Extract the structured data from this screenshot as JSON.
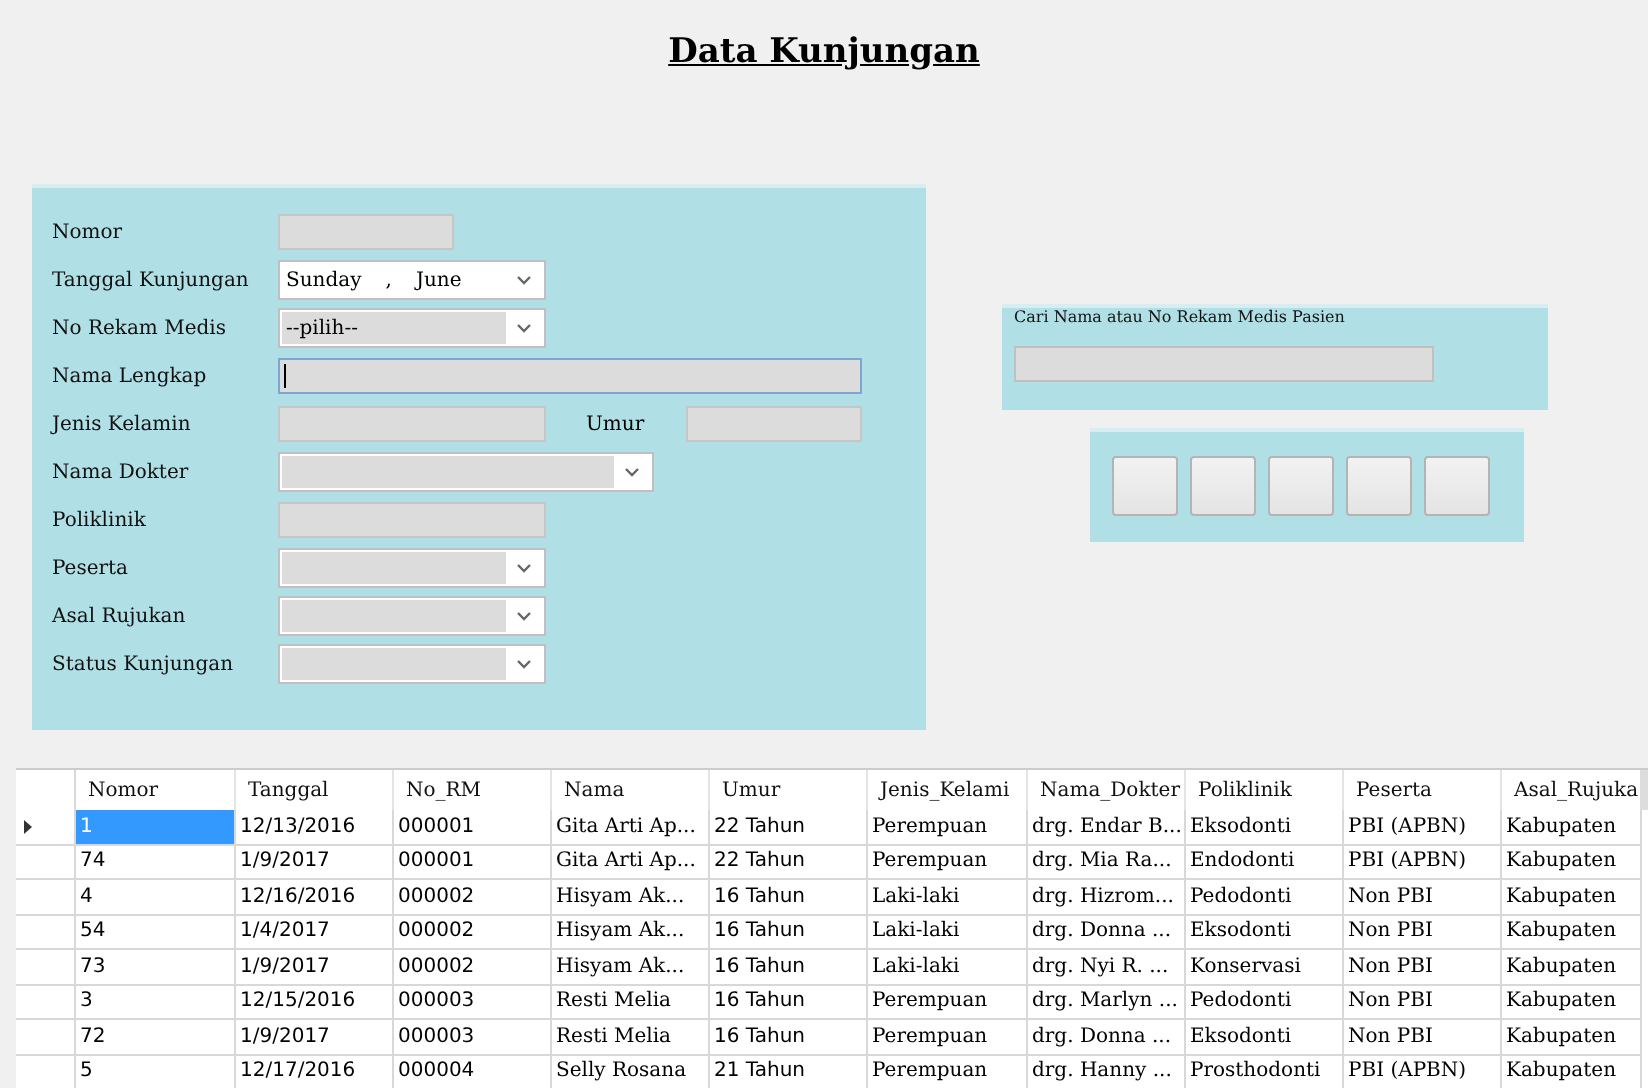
{
  "title": "Data Kunjungan",
  "form": {
    "fields": [
      {
        "label": "Nomor",
        "kind": "text"
      },
      {
        "label": "Tanggal Kunjungan",
        "kind": "date",
        "parts": [
          "Sunday",
          ",",
          "June"
        ]
      },
      {
        "label": "No Rekam Medis",
        "kind": "combo",
        "value": "--pilih--"
      },
      {
        "label": "Nama Lengkap",
        "kind": "text",
        "focused": true
      },
      {
        "label": "Jenis Kelamin",
        "kind": "pair",
        "second_label": "Umur"
      },
      {
        "label": "Nama Dokter",
        "kind": "combo"
      },
      {
        "label": "Poliklinik",
        "kind": "text"
      },
      {
        "label": "Peserta",
        "kind": "combo"
      },
      {
        "label": "Asal Rujukan",
        "kind": "combo"
      },
      {
        "label": "Status Kunjungan",
        "kind": "combo"
      }
    ]
  },
  "search": {
    "legend": "Cari Nama atau No Rekam Medis Pasien"
  },
  "buttons": [
    {
      "kind": "blank"
    },
    {
      "kind": "blank"
    },
    {
      "kind": "blank"
    },
    {
      "kind": "blank"
    },
    {
      "kind": "blank"
    }
  ],
  "table": {
    "columns": [
      "Nomor",
      "Tanggal",
      "No_RM",
      "Nama",
      "Umur",
      "Jenis_Kelami",
      "Nama_Dokter",
      "Poliklinik",
      "Peserta",
      "Asal_Rujuka"
    ],
    "rows": [
      {
        "selected": true,
        "cells": [
          "1",
          "12/13/2016",
          "000001",
          "Gita Arti Ap...",
          "22 Tahun",
          "Perempuan",
          "drg. Endar B...",
          "Eksodonti",
          "PBI (APBN)",
          "Kabupaten"
        ]
      },
      {
        "selected": false,
        "cells": [
          "74",
          "1/9/2017",
          "000001",
          "Gita Arti Ap...",
          "22 Tahun",
          "Perempuan",
          "drg. Mia Ra...",
          "Endodonti",
          "PBI (APBN)",
          "Kabupaten"
        ]
      },
      {
        "selected": false,
        "cells": [
          "4",
          "12/16/2016",
          "000002",
          "Hisyam Ak...",
          "16 Tahun",
          "Laki-laki",
          "drg. Hizrom...",
          "Pedodonti",
          "Non PBI",
          "Kabupaten"
        ]
      },
      {
        "selected": false,
        "cells": [
          "54",
          "1/4/2017",
          "000002",
          "Hisyam Ak...",
          "16 Tahun",
          "Laki-laki",
          "drg. Donna ...",
          "Eksodonti",
          "Non PBI",
          "Kabupaten"
        ]
      },
      {
        "selected": false,
        "cells": [
          "73",
          "1/9/2017",
          "000002",
          "Hisyam Ak...",
          "16 Tahun",
          "Laki-laki",
          "drg. Nyi R. ...",
          "Konservasi",
          "Non PBI",
          "Kabupaten"
        ]
      },
      {
        "selected": false,
        "cells": [
          "3",
          "12/15/2016",
          "000003",
          "Resti Melia",
          "16 Tahun",
          "Perempuan",
          "drg. Marlyn ...",
          "Pedodonti",
          "Non PBI",
          "Kabupaten"
        ]
      },
      {
        "selected": false,
        "cells": [
          "72",
          "1/9/2017",
          "000003",
          "Resti Melia",
          "16 Tahun",
          "Perempuan",
          "drg. Donna ...",
          "Eksodonti",
          "Non PBI",
          "Kabupaten"
        ]
      },
      {
        "selected": false,
        "cells": [
          "5",
          "12/17/2016",
          "000004",
          "Selly Rosana",
          "21 Tahun",
          "Perempuan",
          "drg. Hanny ...",
          "Prosthodonti",
          "PBI (APBN)",
          "Kabupaten"
        ]
      }
    ]
  }
}
